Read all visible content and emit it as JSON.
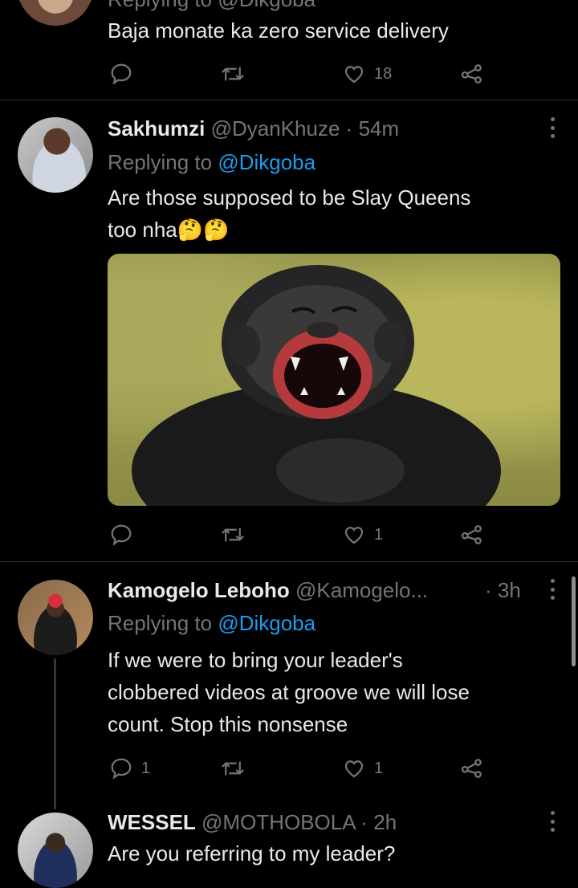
{
  "top_tweet": {
    "cut_reply_text": "Replying to @Dikgoba",
    "text": "Baja monate ka zero service delivery",
    "like_count": "18"
  },
  "tweets": [
    {
      "name": "Sakhumzi",
      "handle": "@DyanKhuze",
      "time": "54m",
      "replying_prefix": "Replying to",
      "replying_to": "@Dikgoba",
      "text_line1": "Are those supposed to be Slay Queens",
      "text_line2": "too nha",
      "emoji": "🤔🤔",
      "like_count": "1"
    },
    {
      "name": "Kamogelo Leboho",
      "handle": "@Kamogelo...",
      "time": "3h",
      "replying_prefix": "Replying to",
      "replying_to": "@Dikgoba",
      "text_line1": "If we were to bring your leader's",
      "text_line2": "clobbered videos at groove we will lose",
      "text_line3": "count. Stop this nonsense",
      "reply_count": "1",
      "like_count": "1"
    },
    {
      "name": "WESSEL",
      "handle": "@MOTHOBOLA",
      "time": "2h",
      "text_line1": "Are you referring to my leader?"
    }
  ],
  "separator": "·",
  "colors": {
    "background": "#000000",
    "text": "#e7e9ea",
    "muted": "#71767b",
    "accent": "#1d9bf0",
    "divider": "#2f3336"
  },
  "icons": [
    "reply-icon",
    "retweet-icon",
    "like-icon",
    "share-icon",
    "more-icon"
  ]
}
